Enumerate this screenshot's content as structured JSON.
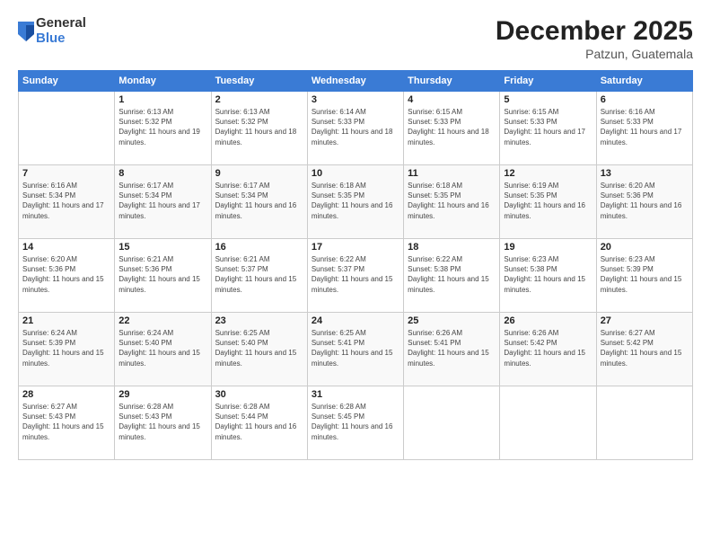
{
  "logo": {
    "general": "General",
    "blue": "Blue"
  },
  "header": {
    "month": "December 2025",
    "location": "Patzun, Guatemala"
  },
  "weekdays": [
    "Sunday",
    "Monday",
    "Tuesday",
    "Wednesday",
    "Thursday",
    "Friday",
    "Saturday"
  ],
  "weeks": [
    [
      {
        "day": "",
        "sunrise": "",
        "sunset": "",
        "daylight": ""
      },
      {
        "day": "1",
        "sunrise": "Sunrise: 6:13 AM",
        "sunset": "Sunset: 5:32 PM",
        "daylight": "Daylight: 11 hours and 19 minutes."
      },
      {
        "day": "2",
        "sunrise": "Sunrise: 6:13 AM",
        "sunset": "Sunset: 5:32 PM",
        "daylight": "Daylight: 11 hours and 18 minutes."
      },
      {
        "day": "3",
        "sunrise": "Sunrise: 6:14 AM",
        "sunset": "Sunset: 5:33 PM",
        "daylight": "Daylight: 11 hours and 18 minutes."
      },
      {
        "day": "4",
        "sunrise": "Sunrise: 6:15 AM",
        "sunset": "Sunset: 5:33 PM",
        "daylight": "Daylight: 11 hours and 18 minutes."
      },
      {
        "day": "5",
        "sunrise": "Sunrise: 6:15 AM",
        "sunset": "Sunset: 5:33 PM",
        "daylight": "Daylight: 11 hours and 17 minutes."
      },
      {
        "day": "6",
        "sunrise": "Sunrise: 6:16 AM",
        "sunset": "Sunset: 5:33 PM",
        "daylight": "Daylight: 11 hours and 17 minutes."
      }
    ],
    [
      {
        "day": "7",
        "sunrise": "Sunrise: 6:16 AM",
        "sunset": "Sunset: 5:34 PM",
        "daylight": "Daylight: 11 hours and 17 minutes."
      },
      {
        "day": "8",
        "sunrise": "Sunrise: 6:17 AM",
        "sunset": "Sunset: 5:34 PM",
        "daylight": "Daylight: 11 hours and 17 minutes."
      },
      {
        "day": "9",
        "sunrise": "Sunrise: 6:17 AM",
        "sunset": "Sunset: 5:34 PM",
        "daylight": "Daylight: 11 hours and 16 minutes."
      },
      {
        "day": "10",
        "sunrise": "Sunrise: 6:18 AM",
        "sunset": "Sunset: 5:35 PM",
        "daylight": "Daylight: 11 hours and 16 minutes."
      },
      {
        "day": "11",
        "sunrise": "Sunrise: 6:18 AM",
        "sunset": "Sunset: 5:35 PM",
        "daylight": "Daylight: 11 hours and 16 minutes."
      },
      {
        "day": "12",
        "sunrise": "Sunrise: 6:19 AM",
        "sunset": "Sunset: 5:35 PM",
        "daylight": "Daylight: 11 hours and 16 minutes."
      },
      {
        "day": "13",
        "sunrise": "Sunrise: 6:20 AM",
        "sunset": "Sunset: 5:36 PM",
        "daylight": "Daylight: 11 hours and 16 minutes."
      }
    ],
    [
      {
        "day": "14",
        "sunrise": "Sunrise: 6:20 AM",
        "sunset": "Sunset: 5:36 PM",
        "daylight": "Daylight: 11 hours and 15 minutes."
      },
      {
        "day": "15",
        "sunrise": "Sunrise: 6:21 AM",
        "sunset": "Sunset: 5:36 PM",
        "daylight": "Daylight: 11 hours and 15 minutes."
      },
      {
        "day": "16",
        "sunrise": "Sunrise: 6:21 AM",
        "sunset": "Sunset: 5:37 PM",
        "daylight": "Daylight: 11 hours and 15 minutes."
      },
      {
        "day": "17",
        "sunrise": "Sunrise: 6:22 AM",
        "sunset": "Sunset: 5:37 PM",
        "daylight": "Daylight: 11 hours and 15 minutes."
      },
      {
        "day": "18",
        "sunrise": "Sunrise: 6:22 AM",
        "sunset": "Sunset: 5:38 PM",
        "daylight": "Daylight: 11 hours and 15 minutes."
      },
      {
        "day": "19",
        "sunrise": "Sunrise: 6:23 AM",
        "sunset": "Sunset: 5:38 PM",
        "daylight": "Daylight: 11 hours and 15 minutes."
      },
      {
        "day": "20",
        "sunrise": "Sunrise: 6:23 AM",
        "sunset": "Sunset: 5:39 PM",
        "daylight": "Daylight: 11 hours and 15 minutes."
      }
    ],
    [
      {
        "day": "21",
        "sunrise": "Sunrise: 6:24 AM",
        "sunset": "Sunset: 5:39 PM",
        "daylight": "Daylight: 11 hours and 15 minutes."
      },
      {
        "day": "22",
        "sunrise": "Sunrise: 6:24 AM",
        "sunset": "Sunset: 5:40 PM",
        "daylight": "Daylight: 11 hours and 15 minutes."
      },
      {
        "day": "23",
        "sunrise": "Sunrise: 6:25 AM",
        "sunset": "Sunset: 5:40 PM",
        "daylight": "Daylight: 11 hours and 15 minutes."
      },
      {
        "day": "24",
        "sunrise": "Sunrise: 6:25 AM",
        "sunset": "Sunset: 5:41 PM",
        "daylight": "Daylight: 11 hours and 15 minutes."
      },
      {
        "day": "25",
        "sunrise": "Sunrise: 6:26 AM",
        "sunset": "Sunset: 5:41 PM",
        "daylight": "Daylight: 11 hours and 15 minutes."
      },
      {
        "day": "26",
        "sunrise": "Sunrise: 6:26 AM",
        "sunset": "Sunset: 5:42 PM",
        "daylight": "Daylight: 11 hours and 15 minutes."
      },
      {
        "day": "27",
        "sunrise": "Sunrise: 6:27 AM",
        "sunset": "Sunset: 5:42 PM",
        "daylight": "Daylight: 11 hours and 15 minutes."
      }
    ],
    [
      {
        "day": "28",
        "sunrise": "Sunrise: 6:27 AM",
        "sunset": "Sunset: 5:43 PM",
        "daylight": "Daylight: 11 hours and 15 minutes."
      },
      {
        "day": "29",
        "sunrise": "Sunrise: 6:28 AM",
        "sunset": "Sunset: 5:43 PM",
        "daylight": "Daylight: 11 hours and 15 minutes."
      },
      {
        "day": "30",
        "sunrise": "Sunrise: 6:28 AM",
        "sunset": "Sunset: 5:44 PM",
        "daylight": "Daylight: 11 hours and 16 minutes."
      },
      {
        "day": "31",
        "sunrise": "Sunrise: 6:28 AM",
        "sunset": "Sunset: 5:45 PM",
        "daylight": "Daylight: 11 hours and 16 minutes."
      },
      {
        "day": "",
        "sunrise": "",
        "sunset": "",
        "daylight": ""
      },
      {
        "day": "",
        "sunrise": "",
        "sunset": "",
        "daylight": ""
      },
      {
        "day": "",
        "sunrise": "",
        "sunset": "",
        "daylight": ""
      }
    ]
  ]
}
